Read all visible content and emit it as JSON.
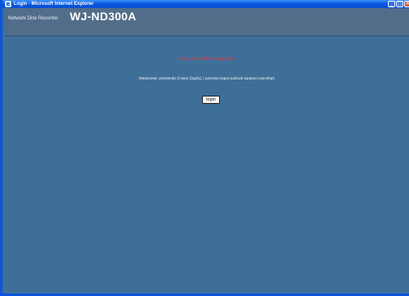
{
  "window": {
    "title": "Login - Microsoft Internet Explorer",
    "buttons": {
      "minimize": "_",
      "maximize": "□",
      "close": "✕"
    },
    "colors": {
      "titlebar": "#0858e0",
      "close_button": "#e05a33",
      "background": "#3e6f98"
    }
  },
  "header": {
    "subtitle": "Network Disk Recorder",
    "model": "WJ-ND300A"
  },
  "main": {
    "heading": "Setup dello HDD completato",
    "message": "Attenzione: premendo il tasto [login], i processi sopra indicati saranno cancellati.",
    "login_button": "login",
    "heading_color": "#e03a3a"
  }
}
